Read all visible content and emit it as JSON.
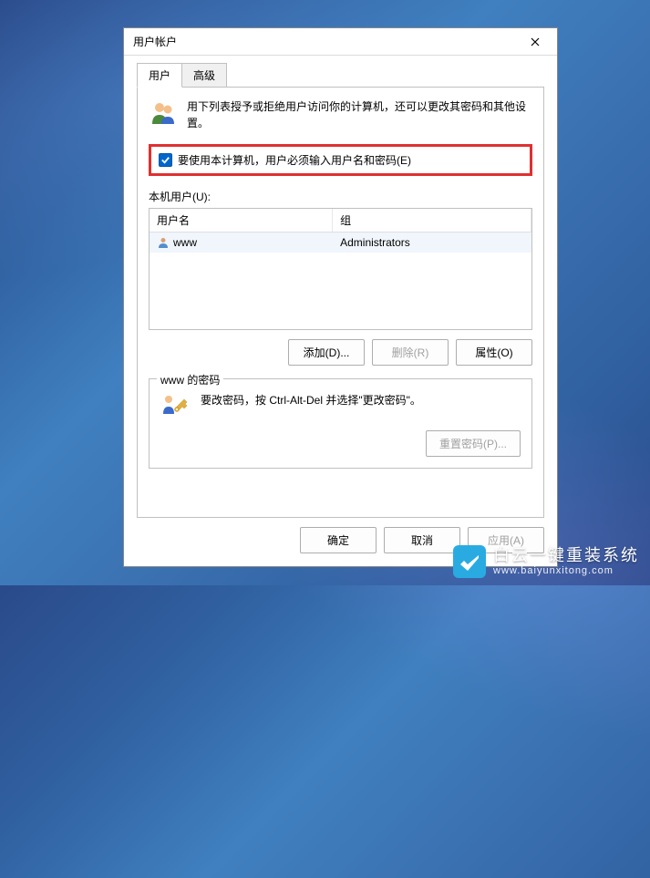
{
  "window": {
    "title": "用户帐户"
  },
  "tabs": {
    "user": "用户",
    "advanced": "高级"
  },
  "intro": "用下列表授予或拒绝用户访问你的计算机，还可以更改其密码和其他设置。",
  "checkbox": {
    "label": "要使用本计算机，用户必须输入用户名和密码(E)",
    "checked": true
  },
  "list": {
    "label": "本机用户(U):",
    "headers": {
      "name": "用户名",
      "group": "组"
    },
    "rows": [
      {
        "name": "www",
        "group": "Administrators"
      }
    ]
  },
  "buttons": {
    "add": "添加(D)...",
    "remove": "删除(R)",
    "properties": "属性(O)"
  },
  "password_panel": {
    "legend": "www 的密码",
    "text": "要改密码，按 Ctrl-Alt-Del 并选择\"更改密码\"。",
    "reset": "重置密码(P)..."
  },
  "dialog_buttons": {
    "ok": "确定",
    "cancel": "取消",
    "apply": "应用(A)"
  },
  "watermark": {
    "name": "白云一键重装系统",
    "url": "www.baiyunxitong.com"
  }
}
